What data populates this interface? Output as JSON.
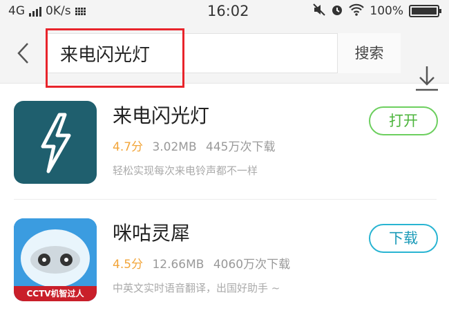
{
  "status_bar": {
    "network": "4G",
    "speed": "0K/s",
    "time": "16:02",
    "battery": "100%"
  },
  "search": {
    "query": "来电闪光灯",
    "search_button": "搜索",
    "highlight_color": "#e8242b"
  },
  "results": [
    {
      "name": "来电闪光灯",
      "rating": "4.7分",
      "size": "3.02MB",
      "downloads": "445万次下载",
      "description": "轻松实现每次来电铃声都不一样",
      "action": "打开",
      "icon": "lightning-bolt-icon",
      "icon_bg": "#1f5f6e"
    },
    {
      "name": "咪咕灵犀",
      "rating": "4.5分",
      "size": "12.66MB",
      "downloads": "4060万次下载",
      "description": "中英文实时语音翻译，出国好助手 ~",
      "action": "下载",
      "icon": "cctv-robot-icon",
      "icon_badge": "CCTV机智过人"
    }
  ]
}
